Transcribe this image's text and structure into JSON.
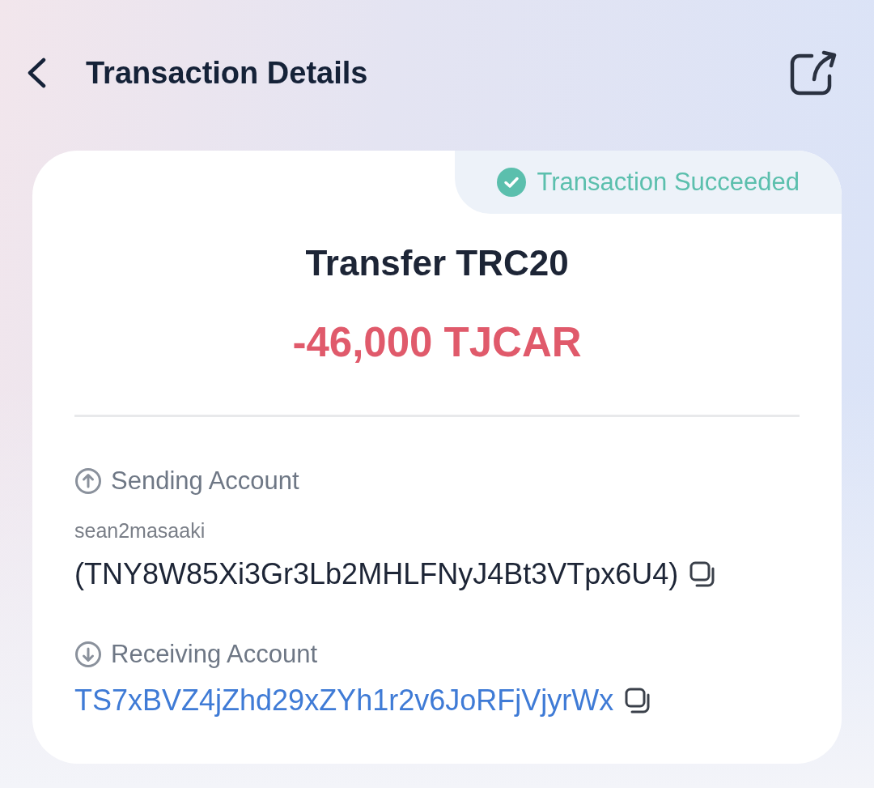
{
  "header": {
    "title": "Transaction Details"
  },
  "status": {
    "kind": "success",
    "label": "Transaction Succeeded"
  },
  "transaction": {
    "type": "Transfer TRC20",
    "amount": "-46,000 TJCAR"
  },
  "accounts": [
    {
      "kind": "sending",
      "label": "Sending Account",
      "name": "sean2masaaki",
      "address": "(TNY8W85Xi3Gr3Lb2MHLFNyJ4Bt3VTpx6U4)",
      "link": false
    },
    {
      "kind": "receiving",
      "label": "Receiving Account",
      "address": "TS7xBVZ4jZhd29xZYh1r2v6JoRFjVjyrWx",
      "link": true
    }
  ]
}
